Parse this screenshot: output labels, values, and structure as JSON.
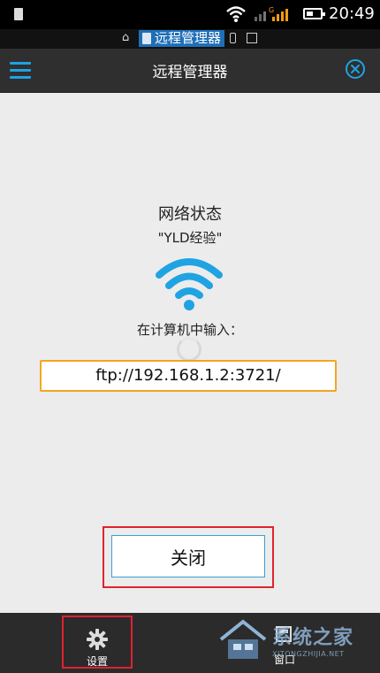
{
  "status_bar": {
    "time": "20:49",
    "network_label": "G"
  },
  "notification_bar": {
    "title": "远程管理器"
  },
  "app_bar": {
    "title": "远程管理器"
  },
  "main": {
    "network_status_label": "网络状态",
    "network_name": "\"YLD经验\"",
    "instruction": "在计算机中输入：",
    "ftp_address": "ftp://192.168.1.2:3721/",
    "close_button_label": "关闭"
  },
  "bottom_nav": {
    "items": [
      {
        "label": "设置",
        "icon": "gear-icon"
      },
      {
        "label": "窗口",
        "icon": "window-icon"
      }
    ]
  },
  "watermark": {
    "text": "系统之家",
    "subtext": "XITONGZHIJIA.NET"
  },
  "colors": {
    "accent": "#1fa3e2",
    "highlight_border": "#e0232c",
    "input_border": "#f4a521",
    "appbar_bg": "#2f2f2f"
  }
}
